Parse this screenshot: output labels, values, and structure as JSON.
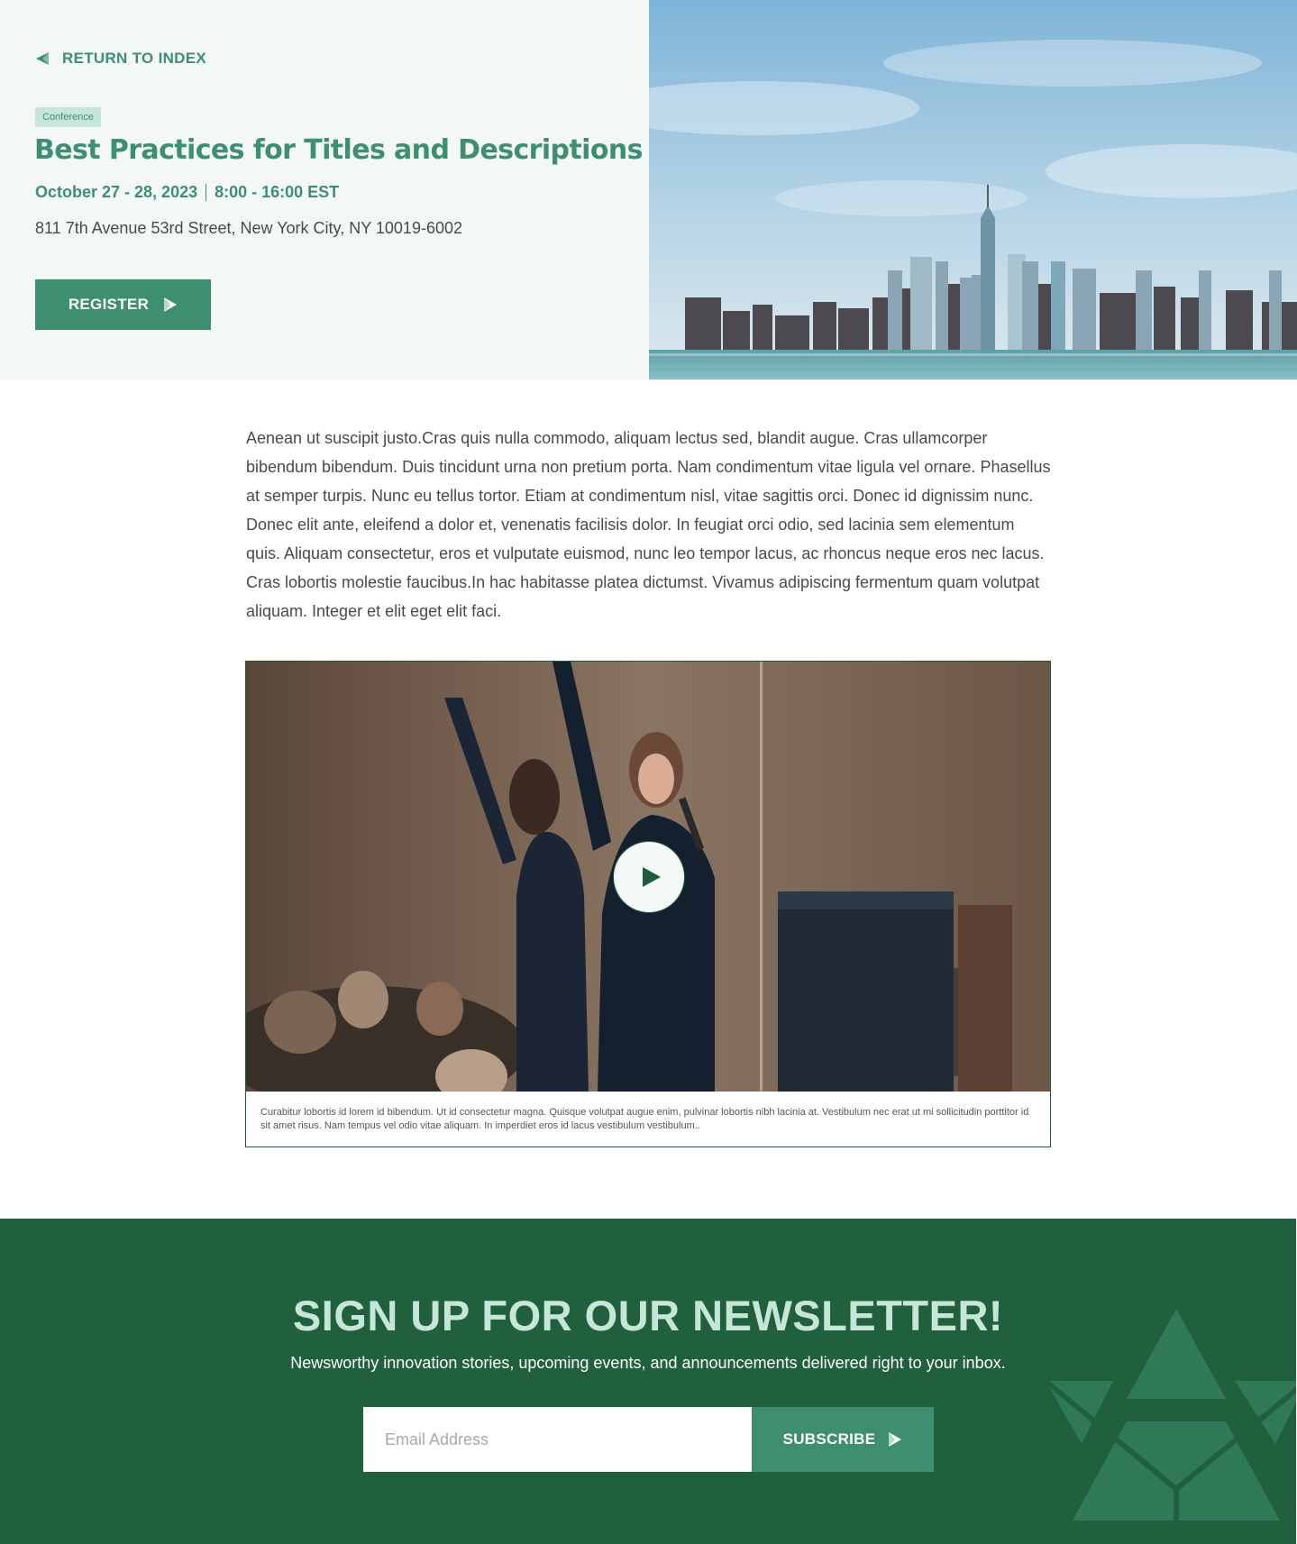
{
  "hero": {
    "return_label": "RETURN TO INDEX",
    "tag": "Conference",
    "title": "Best Practices for Titles and Descriptions",
    "date": "October 27 - 28, 2023",
    "time": "8:00 - 16:00 EST",
    "address": "811 7th Avenue 53rd Street, New York City, NY 10019-6002",
    "register_label": "REGISTER"
  },
  "body": {
    "paragraph": "Aenean ut suscipit justo.Cras quis nulla commodo, aliquam lectus sed, blandit augue. Cras ullamcorper bibendum bibendum. Duis tincidunt urna non pretium porta. Nam condimentum vitae ligula vel ornare. Phasellus at semper turpis. Nunc eu tellus tortor. Etiam at condimentum nisl, vitae sagittis orci. Donec id dignissim nunc. Donec elit ante, eleifend a dolor et, venenatis facilisis dolor. In feugiat orci odio, sed lacinia sem elementum quis. Aliquam consectetur, eros et vulputate euismod, nunc leo tempor lacus, ac rhoncus neque eros nec lacus. Cras lobortis molestie faucibus.In hac habitasse platea dictumst. Vivamus adipiscing fermentum quam volutpat aliquam. Integer et elit eget elit faci."
  },
  "video": {
    "caption": "Curabitur lobortis id lorem id bibendum. Ut id consectetur magna. Quisque volutpat augue enim, pulvinar lobortis nibh lacinia at. Vestibulum nec erat ut mi sollicitudin porttitor id sit amet risus. Nam tempus vel odio vitae aliquam. In imperdiet eros id lacus vestibulum vestibulum.."
  },
  "newsletter": {
    "title": "SIGN UP FOR OUR NEWSLETTER!",
    "subtitle": "Newsworthy innovation stories, upcoming events, and announcements delivered right to your inbox.",
    "email_placeholder": "Email Address",
    "subscribe_label": "SUBSCRIBE"
  },
  "icons": {
    "return": "triangle-arrow-left-icon",
    "register": "triangle-arrow-right-icon",
    "play": "play-icon",
    "subscribe": "triangle-arrow-right-icon",
    "decoration": "triangle-logo-icon"
  },
  "colors": {
    "brand_green": "#3e8f70",
    "dark_green": "#20603c",
    "mint": "#c6e6d9",
    "hero_bg": "#f3f8f6"
  }
}
